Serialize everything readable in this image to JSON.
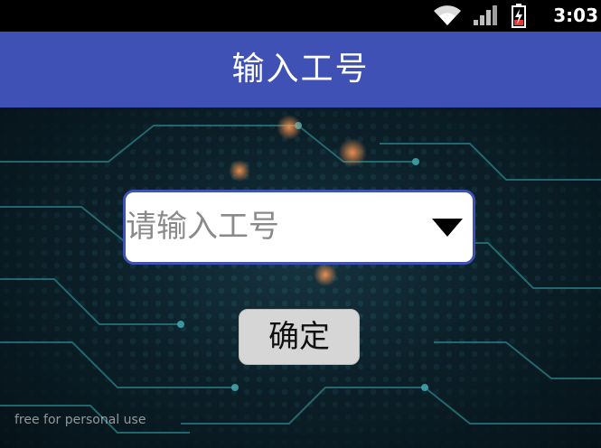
{
  "status_bar": {
    "time": "3:03",
    "icons": [
      "wifi-icon",
      "signal-icon",
      "battery-charging-icon"
    ]
  },
  "app_bar": {
    "title": "输入工号"
  },
  "form": {
    "employee_id_spinner": {
      "placeholder": "请输入工号",
      "icon": "dropdown-arrow-icon"
    },
    "confirm_label": "确定"
  },
  "watermark": "free for personal use",
  "colors": {
    "app_bar": "#3f51b5",
    "spinner_border": "#3f51b5",
    "button_bg": "#d6d6d6"
  }
}
